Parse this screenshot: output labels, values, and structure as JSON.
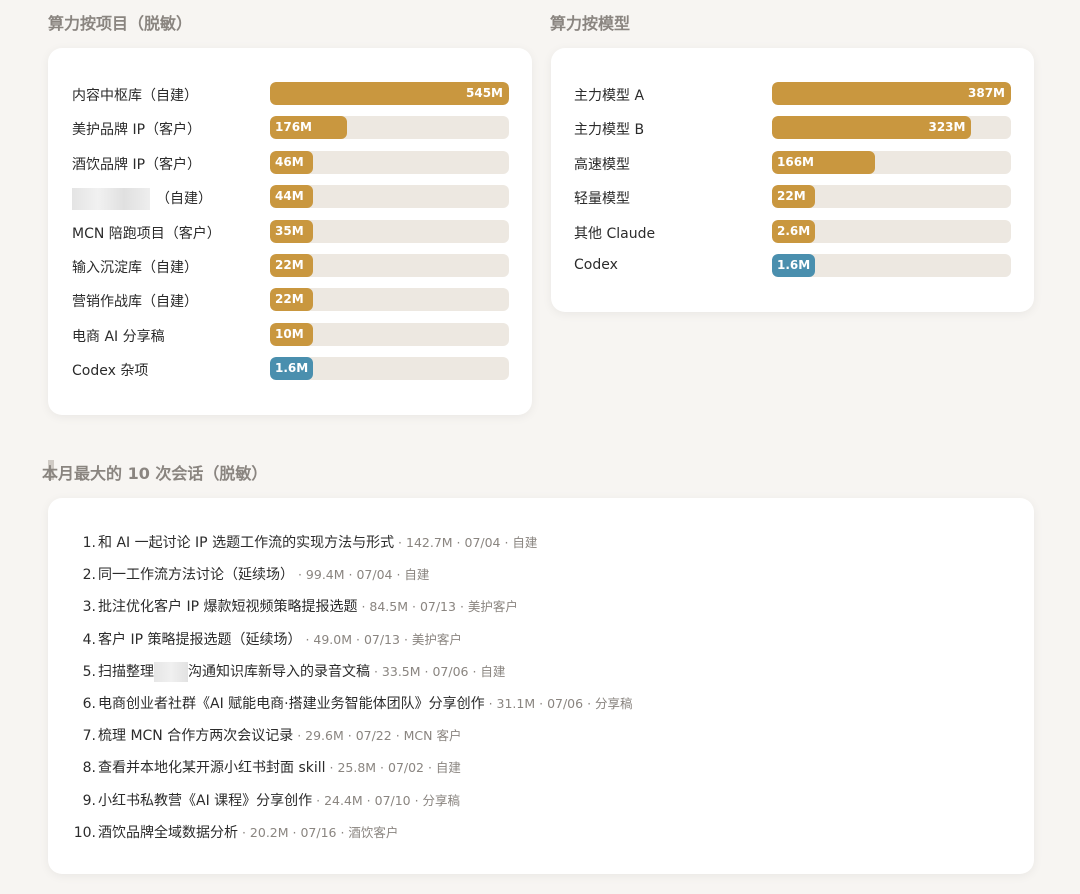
{
  "colors": {
    "bar_primary": "#c9973f",
    "bar_codex": "#4a8fae",
    "track": "#ede8e1"
  },
  "project_section": {
    "title": "算力按项目（脱敏）",
    "chart_data": {
      "type": "bar",
      "orientation": "horizontal",
      "title": "算力按项目（脱敏）",
      "categories": [
        "内容中枢库（自建）",
        "美护品牌 IP（客户）",
        "酒饮品牌 IP（客户）",
        "（自建）",
        "MCN 陪跑项目（客户）",
        "输入沉淀库（自建）",
        "营销作战库（自建）",
        "电商 AI 分享稿",
        "Codex 杂项"
      ],
      "values": [
        545,
        176,
        46,
        44,
        35,
        22,
        22,
        10,
        1.6
      ],
      "value_labels": [
        "545M",
        "176M",
        "46M",
        "44M",
        "35M",
        "22M",
        "22M",
        "10M",
        "1.6M"
      ],
      "bar_colors": [
        "#c9973f",
        "#c9973f",
        "#c9973f",
        "#c9973f",
        "#c9973f",
        "#c9973f",
        "#c9973f",
        "#c9973f",
        "#4a8fae"
      ],
      "xlim": [
        0,
        545
      ]
    }
  },
  "model_section": {
    "title": "算力按模型",
    "chart_data": {
      "type": "bar",
      "orientation": "horizontal",
      "title": "算力按模型",
      "categories": [
        "主力模型 A",
        "主力模型 B",
        "高速模型",
        "轻量模型",
        "其他 Claude",
        "Codex"
      ],
      "values": [
        387,
        323,
        166,
        22,
        2.6,
        1.6
      ],
      "value_labels": [
        "387M",
        "323M",
        "166M",
        "22M",
        "2.6M",
        "1.6M"
      ],
      "bar_colors": [
        "#c9973f",
        "#c9973f",
        "#c9973f",
        "#c9973f",
        "#c9973f",
        "#4a8fae"
      ],
      "xlim": [
        0,
        387
      ]
    }
  },
  "sessions_section": {
    "title": "本月最大的 10 次会话（脱敏）",
    "items": [
      {
        "num": "1.",
        "title": "和 AI 一起讨论 IP 选题工作流的实现方法与形式",
        "meta": " · 142.7M · 07/04 · 自建"
      },
      {
        "num": "2.",
        "title": "同一工作流方法讨论（延续场）",
        "meta": " · 99.4M · 07/04 · 自建"
      },
      {
        "num": "3.",
        "title": "批注优化客户 IP 爆款短视频策略提报选题",
        "meta": " · 84.5M · 07/13 · 美护客户"
      },
      {
        "num": "4.",
        "title": "客户 IP 策略提报选题（延续场）",
        "meta": " · 49.0M · 07/13 · 美护客户"
      },
      {
        "num": "5.",
        "title_pre": "扫描整理",
        "title_post": "沟通知识库新导入的录音文稿",
        "meta": " · 33.5M · 07/06 · 自建"
      },
      {
        "num": "6.",
        "title": "电商创业者社群《AI 赋能电商·搭建业务智能体团队》分享创作",
        "meta": " · 31.1M · 07/06 · 分享稿"
      },
      {
        "num": "7.",
        "title": "梳理 MCN 合作方两次会议记录",
        "meta": " · 29.6M · 07/22 · MCN 客户"
      },
      {
        "num": "8.",
        "title": "查看并本地化某开源小红书封面 skill",
        "meta": " · 25.8M · 07/02 · 自建"
      },
      {
        "num": "9.",
        "title": "小红书私教营《AI 课程》分享创作",
        "meta": " · 24.4M · 07/10 · 分享稿"
      },
      {
        "num": "10.",
        "title": "酒饮品牌全域数据分析",
        "meta": " · 20.2M · 07/16 · 酒饮客户"
      }
    ]
  }
}
